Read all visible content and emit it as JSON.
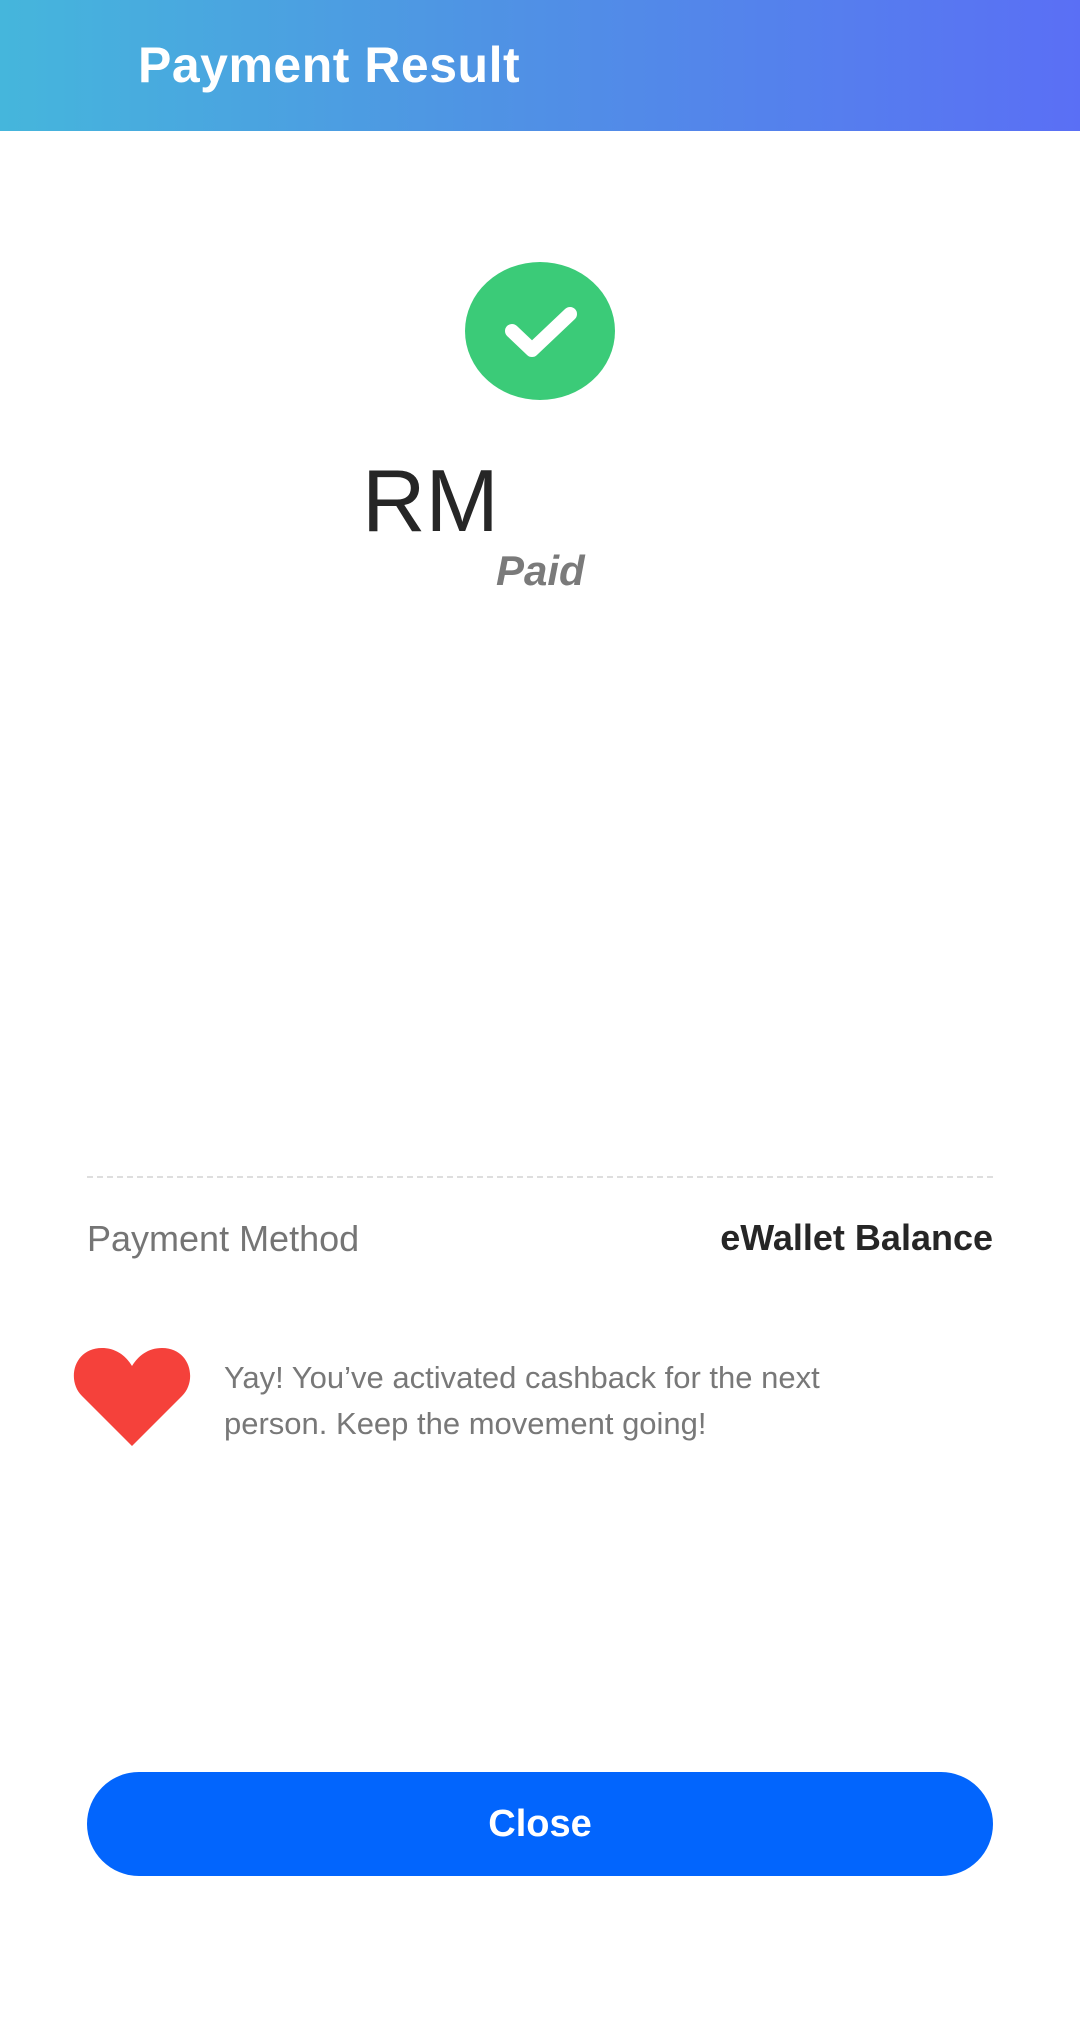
{
  "header": {
    "title": "Payment Result"
  },
  "result": {
    "status_icon": "check-icon",
    "status_color": "#3bcb78",
    "amount": "RM",
    "status_text": "Paid"
  },
  "details": {
    "payment_method_label": "Payment Method",
    "payment_method_value": "eWallet Balance"
  },
  "cashback": {
    "icon": "heart-icon",
    "icon_color": "#f5413b",
    "message": "Yay! You’ve activated cashback for the next person. Keep the movement going!"
  },
  "actions": {
    "close_label": "Close",
    "close_color": "#0265fd"
  },
  "colors": {
    "header_gradient_start": "#45b6dc",
    "header_gradient_end": "#5a6ff5"
  }
}
